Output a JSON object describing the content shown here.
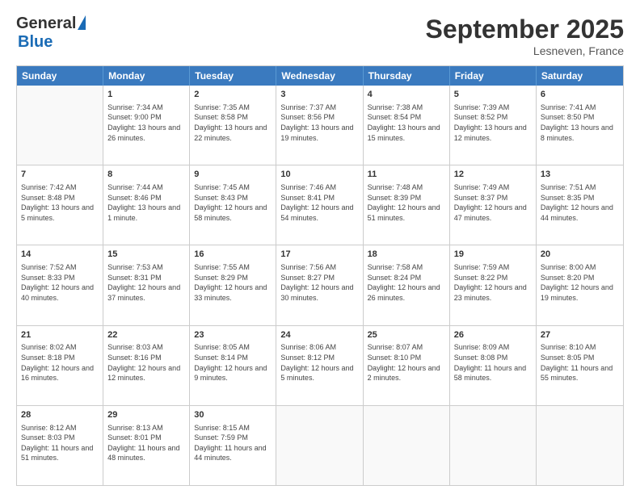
{
  "header": {
    "logo_general": "General",
    "logo_blue": "Blue",
    "month_title": "September 2025",
    "location": "Lesneven, France"
  },
  "weekdays": [
    "Sunday",
    "Monday",
    "Tuesday",
    "Wednesday",
    "Thursday",
    "Friday",
    "Saturday"
  ],
  "rows": [
    [
      {
        "day": "",
        "empty": true
      },
      {
        "day": "1",
        "sunrise": "7:34 AM",
        "sunset": "9:00 PM",
        "daylight": "13 hours and 26 minutes."
      },
      {
        "day": "2",
        "sunrise": "7:35 AM",
        "sunset": "8:58 PM",
        "daylight": "13 hours and 22 minutes."
      },
      {
        "day": "3",
        "sunrise": "7:37 AM",
        "sunset": "8:56 PM",
        "daylight": "13 hours and 19 minutes."
      },
      {
        "day": "4",
        "sunrise": "7:38 AM",
        "sunset": "8:54 PM",
        "daylight": "13 hours and 15 minutes."
      },
      {
        "day": "5",
        "sunrise": "7:39 AM",
        "sunset": "8:52 PM",
        "daylight": "13 hours and 12 minutes."
      },
      {
        "day": "6",
        "sunrise": "7:41 AM",
        "sunset": "8:50 PM",
        "daylight": "13 hours and 8 minutes."
      }
    ],
    [
      {
        "day": "7",
        "sunrise": "7:42 AM",
        "sunset": "8:48 PM",
        "daylight": "13 hours and 5 minutes."
      },
      {
        "day": "8",
        "sunrise": "7:44 AM",
        "sunset": "8:46 PM",
        "daylight": "13 hours and 1 minute."
      },
      {
        "day": "9",
        "sunrise": "7:45 AM",
        "sunset": "8:43 PM",
        "daylight": "12 hours and 58 minutes."
      },
      {
        "day": "10",
        "sunrise": "7:46 AM",
        "sunset": "8:41 PM",
        "daylight": "12 hours and 54 minutes."
      },
      {
        "day": "11",
        "sunrise": "7:48 AM",
        "sunset": "8:39 PM",
        "daylight": "12 hours and 51 minutes."
      },
      {
        "day": "12",
        "sunrise": "7:49 AM",
        "sunset": "8:37 PM",
        "daylight": "12 hours and 47 minutes."
      },
      {
        "day": "13",
        "sunrise": "7:51 AM",
        "sunset": "8:35 PM",
        "daylight": "12 hours and 44 minutes."
      }
    ],
    [
      {
        "day": "14",
        "sunrise": "7:52 AM",
        "sunset": "8:33 PM",
        "daylight": "12 hours and 40 minutes."
      },
      {
        "day": "15",
        "sunrise": "7:53 AM",
        "sunset": "8:31 PM",
        "daylight": "12 hours and 37 minutes."
      },
      {
        "day": "16",
        "sunrise": "7:55 AM",
        "sunset": "8:29 PM",
        "daylight": "12 hours and 33 minutes."
      },
      {
        "day": "17",
        "sunrise": "7:56 AM",
        "sunset": "8:27 PM",
        "daylight": "12 hours and 30 minutes."
      },
      {
        "day": "18",
        "sunrise": "7:58 AM",
        "sunset": "8:24 PM",
        "daylight": "12 hours and 26 minutes."
      },
      {
        "day": "19",
        "sunrise": "7:59 AM",
        "sunset": "8:22 PM",
        "daylight": "12 hours and 23 minutes."
      },
      {
        "day": "20",
        "sunrise": "8:00 AM",
        "sunset": "8:20 PM",
        "daylight": "12 hours and 19 minutes."
      }
    ],
    [
      {
        "day": "21",
        "sunrise": "8:02 AM",
        "sunset": "8:18 PM",
        "daylight": "12 hours and 16 minutes."
      },
      {
        "day": "22",
        "sunrise": "8:03 AM",
        "sunset": "8:16 PM",
        "daylight": "12 hours and 12 minutes."
      },
      {
        "day": "23",
        "sunrise": "8:05 AM",
        "sunset": "8:14 PM",
        "daylight": "12 hours and 9 minutes."
      },
      {
        "day": "24",
        "sunrise": "8:06 AM",
        "sunset": "8:12 PM",
        "daylight": "12 hours and 5 minutes."
      },
      {
        "day": "25",
        "sunrise": "8:07 AM",
        "sunset": "8:10 PM",
        "daylight": "12 hours and 2 minutes."
      },
      {
        "day": "26",
        "sunrise": "8:09 AM",
        "sunset": "8:08 PM",
        "daylight": "11 hours and 58 minutes."
      },
      {
        "day": "27",
        "sunrise": "8:10 AM",
        "sunset": "8:05 PM",
        "daylight": "11 hours and 55 minutes."
      }
    ],
    [
      {
        "day": "28",
        "sunrise": "8:12 AM",
        "sunset": "8:03 PM",
        "daylight": "11 hours and 51 minutes."
      },
      {
        "day": "29",
        "sunrise": "8:13 AM",
        "sunset": "8:01 PM",
        "daylight": "11 hours and 48 minutes."
      },
      {
        "day": "30",
        "sunrise": "8:15 AM",
        "sunset": "7:59 PM",
        "daylight": "11 hours and 44 minutes."
      },
      {
        "day": "",
        "empty": true
      },
      {
        "day": "",
        "empty": true
      },
      {
        "day": "",
        "empty": true
      },
      {
        "day": "",
        "empty": true
      }
    ]
  ]
}
